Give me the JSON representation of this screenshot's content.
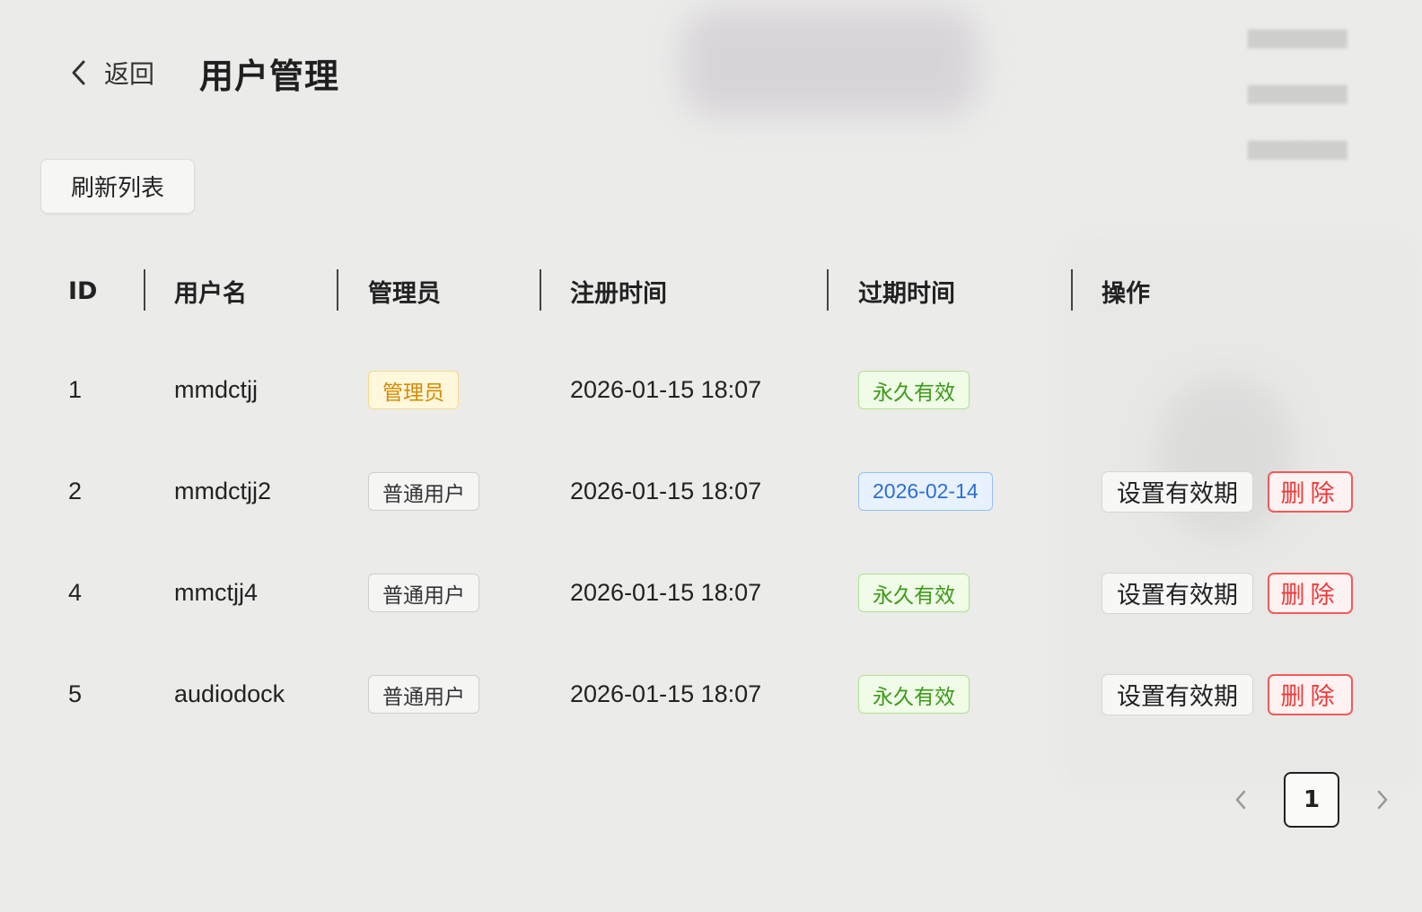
{
  "header": {
    "back_label": "返回",
    "title": "用户管理"
  },
  "toolbar": {
    "refresh_label": "刷新列表"
  },
  "table": {
    "columns": [
      "ID",
      "用户名",
      "管理员",
      "注册时间",
      "过期时间",
      "操作"
    ],
    "rows": [
      {
        "id": "1",
        "username": "mmdctjj",
        "role": "管理员",
        "registered": "2026-01-15 18:07",
        "expiry": "永久有效",
        "actions": false
      },
      {
        "id": "2",
        "username": "mmdctjj2",
        "role": "普通用户",
        "registered": "2026-01-15 18:07",
        "expiry": "2026-02-14",
        "actions": true
      },
      {
        "id": "4",
        "username": "mmctjj4",
        "role": "普通用户",
        "registered": "2026-01-15 18:07",
        "expiry": "永久有效",
        "actions": true
      },
      {
        "id": "5",
        "username": "audiodock",
        "role": "普通用户",
        "registered": "2026-01-15 18:07",
        "expiry": "永久有效",
        "actions": true
      }
    ],
    "actions": {
      "set_expiry_label": "设置有效期",
      "delete_label": "删除"
    }
  },
  "pagination": {
    "current_page": "1"
  },
  "colors": {
    "admin_tag": "#d68a00",
    "forever_tag": "#3c9b17",
    "date_tag": "#2a6fd6",
    "delete": "#ef3a3a"
  }
}
